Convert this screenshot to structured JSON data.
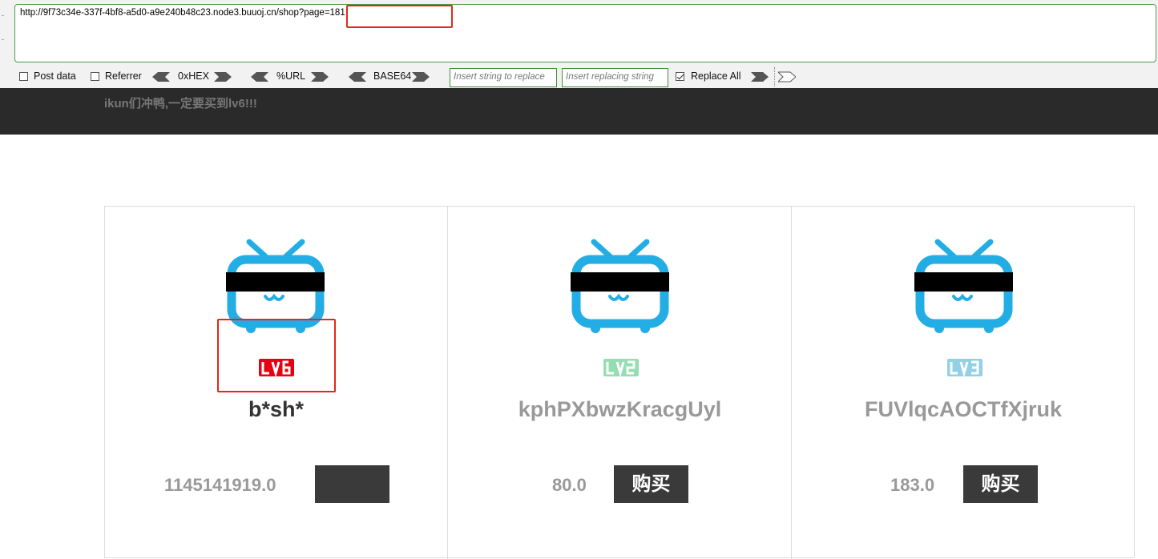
{
  "hackbar": {
    "url": "http://9f73c34e-337f-4bf8-a5d0-a9e240b48c23.node3.buuoj.cn/shop?page=181",
    "post_data_label": "Post data",
    "referrer_label": "Referrer",
    "hex_label": "0xHEX",
    "url_label": "%URL",
    "base64_label": "BASE64",
    "insert_string_placeholder": "Insert string to replace",
    "insert_replacing_placeholder": "Insert replacing string",
    "replace_all_label": "Replace All",
    "post_data_checked": false,
    "referrer_checked": false,
    "replace_all_checked": true
  },
  "header": {
    "slogan": "ikun们冲鸭,一定要买到lv6!!!"
  },
  "products": [
    {
      "level": "LV6",
      "level_color": "#e60012",
      "name": "b*sh*",
      "name_color": "#333333",
      "price": "1145141919.0",
      "buy_label": ""
    },
    {
      "level": "LV2",
      "level_color": "#95ddb2",
      "name": "kphPXbwzKracgUyl",
      "name_color": "#999999",
      "price": "80.0",
      "buy_label": "购买"
    },
    {
      "level": "LV3",
      "level_color": "#92d1e5",
      "name": "FUVlqcAOCTfXjruk",
      "name_color": "#999999",
      "price": "183.0",
      "buy_label": "购买"
    }
  ],
  "colors": {
    "tv_blue": "#23ade5",
    "dark_header": "#2a2a2a",
    "highlight_red": "#e5261c"
  },
  "icons": [
    "bilibili-tv-icon",
    "arrow-left-icon",
    "arrow-right-icon"
  ]
}
